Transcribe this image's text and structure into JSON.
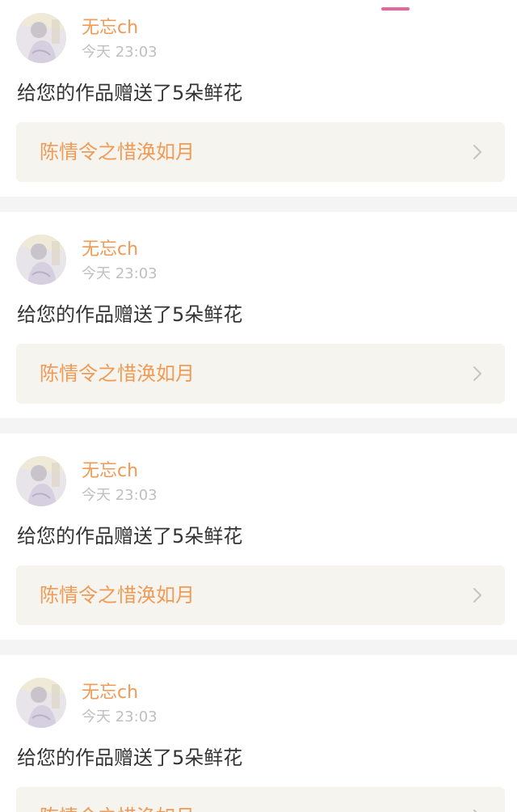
{
  "notifications": [
    {
      "username": "无忘ch",
      "time": "今天 23:03",
      "message": "给您的作品赠送了5朵鲜花",
      "work_title": "陈情令之惜涣如月"
    },
    {
      "username": "无忘ch",
      "time": "今天 23:03",
      "message": "给您的作品赠送了5朵鲜花",
      "work_title": "陈情令之惜涣如月"
    },
    {
      "username": "无忘ch",
      "time": "今天 23:03",
      "message": "给您的作品赠送了5朵鲜花",
      "work_title": "陈情令之惜涣如月"
    },
    {
      "username": "无忘ch",
      "time": "今天 23:03",
      "message": "给您的作品赠送了5朵鲜花",
      "work_title": "陈情令之惜涣如月"
    }
  ],
  "icons": {
    "chevron": "chevron-right-icon",
    "avatar": "user-avatar"
  },
  "colors": {
    "accent": "#ef9a55",
    "tab_indicator": "#e4669a",
    "card_background": "#ffffff",
    "link_background": "#f5f4ef",
    "page_background": "#f4f4f4"
  }
}
